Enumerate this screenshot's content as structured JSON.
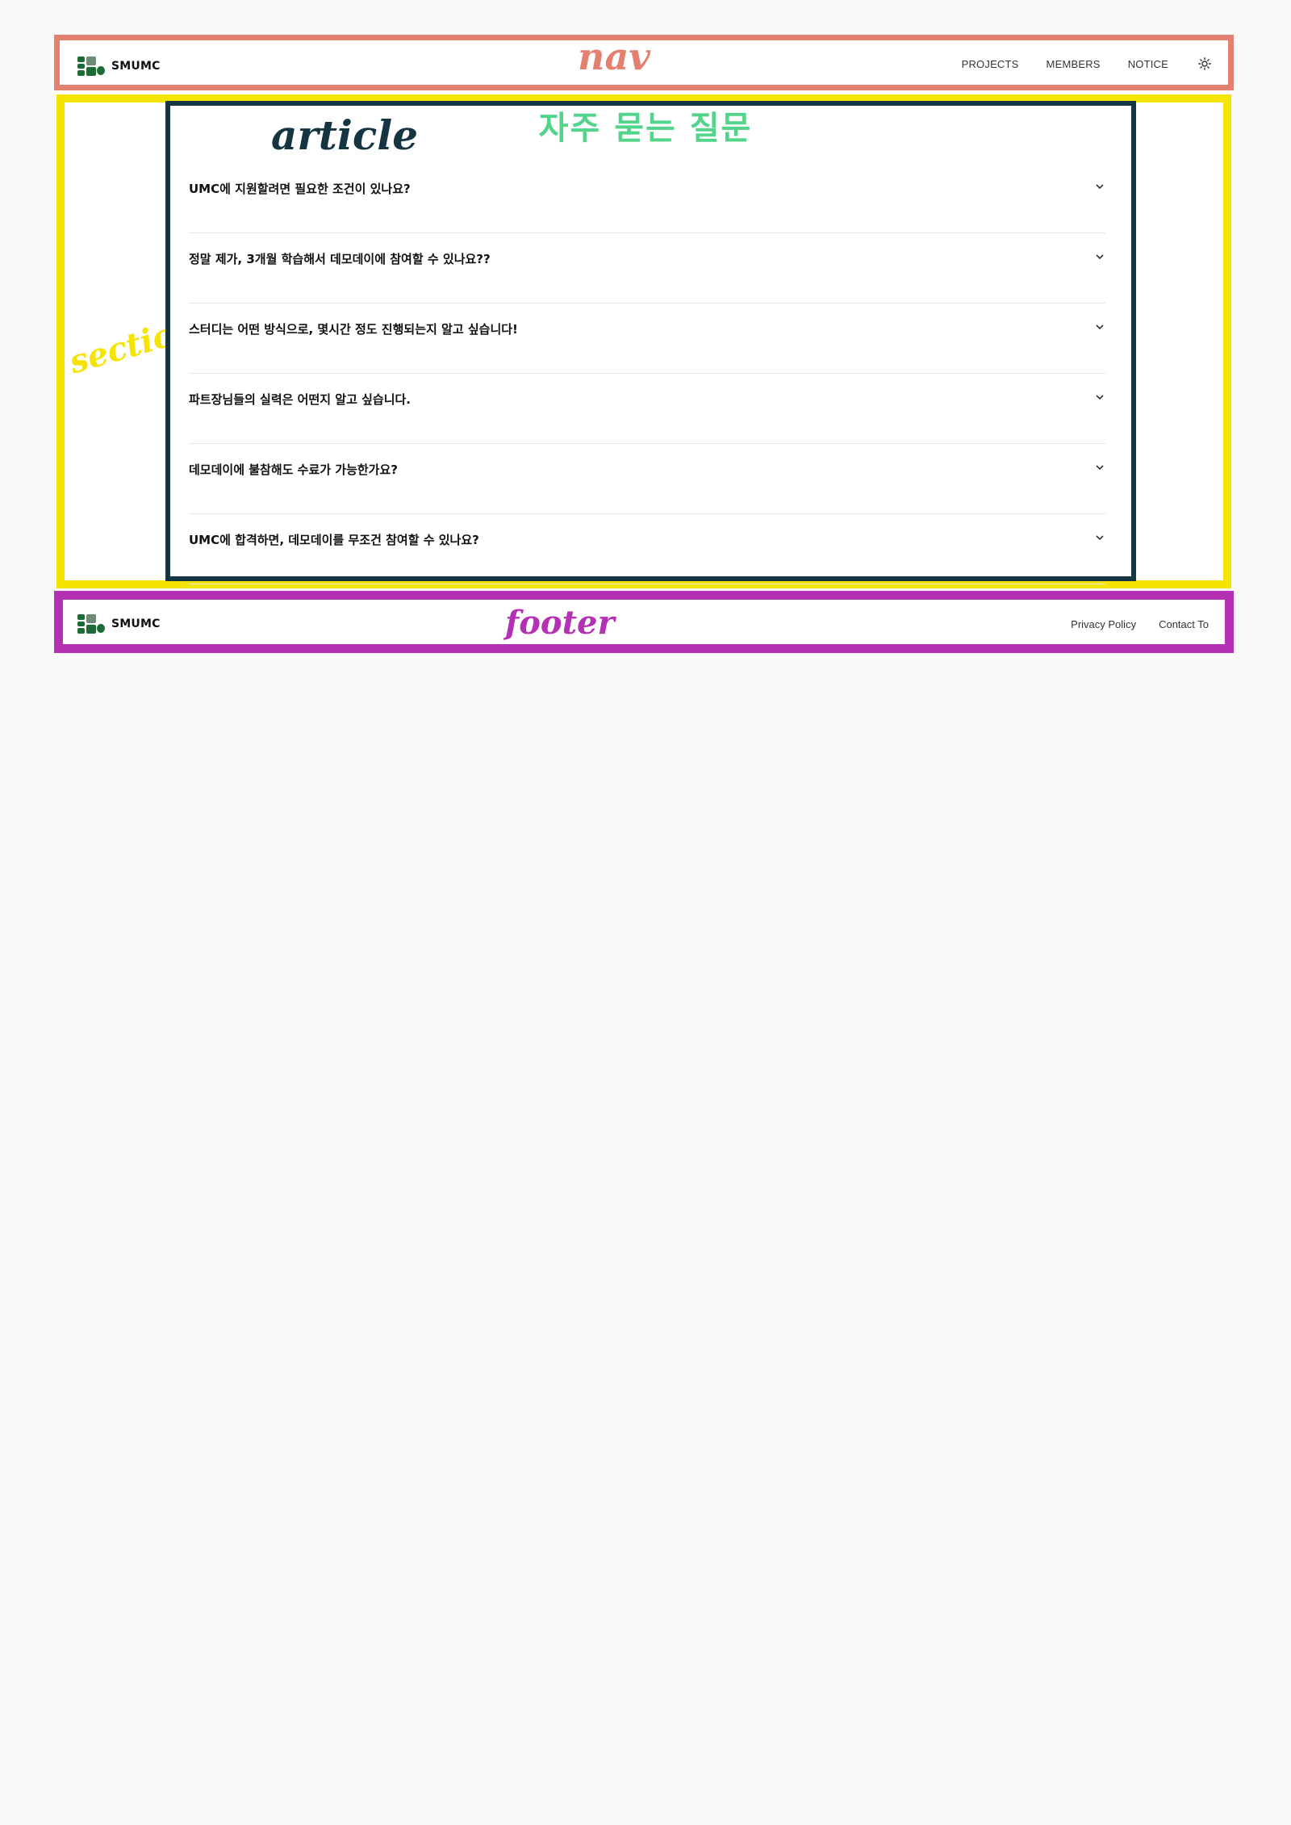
{
  "nav": {
    "brand": "SMUMC",
    "links": [
      "PROJECTS",
      "MEMBERS",
      "NOTICE"
    ],
    "theme_icon": "sun-icon",
    "annotation": "nav"
  },
  "section": {
    "annotation": "section"
  },
  "article": {
    "annotation": "article",
    "title": "자주 묻는 질문",
    "questions": [
      "UMC에 지원할려면 필요한 조건이 있나요?",
      "정말 제가, 3개월 학습해서 데모데이에 참여할 수 있나요??",
      "스터디는 어떤 방식으로, 몇시간 정도 진행되는지 알고 싶습니다!",
      "파트장님들의 실력은 어떤지 알고 싶습니다.",
      "데모데이에 불참해도 수료가 가능한가요?",
      "UMC에 합격하면, 데모데이를 무조건 참여할 수 있나요?"
    ],
    "chevron_icon": "chevron-down-icon"
  },
  "footer": {
    "brand": "SMUMC",
    "links": [
      "Privacy Policy",
      "Contact To"
    ],
    "annotation": "footer"
  },
  "colors": {
    "nav_frame": "#e4806f",
    "section_frame": "#f5e400",
    "article_frame": "#163543",
    "footer_frame": "#b531b4",
    "faq_title": "#52d48a",
    "brand_green": "#1f6b35",
    "background": "#fafafa"
  }
}
